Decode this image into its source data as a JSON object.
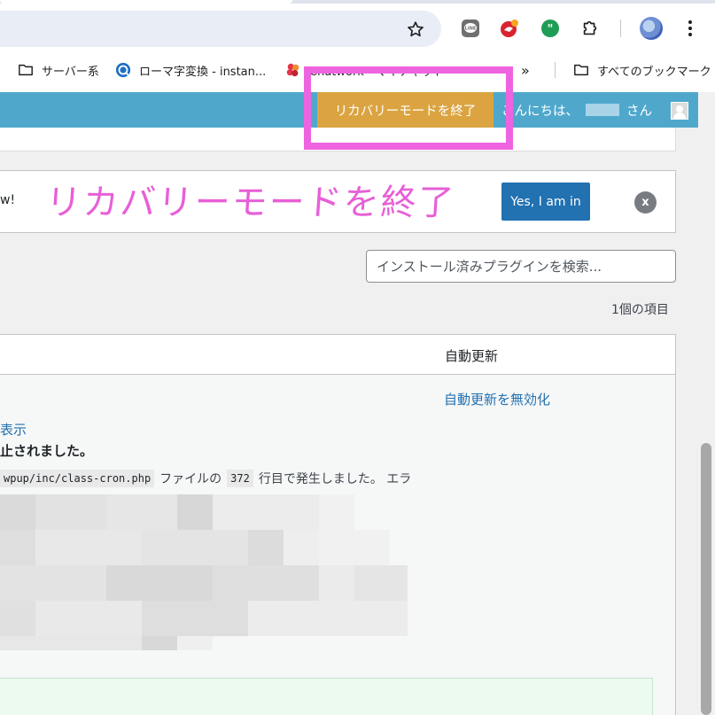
{
  "browser": {
    "bookmarks": [
      {
        "label": "サーバー系",
        "icon": "folder-icon"
      },
      {
        "label": "ローマ字変換 - instan...",
        "icon": "globe-icon"
      },
      {
        "label": "Chatwork - マイチャット",
        "icon": "chatwork-icon"
      }
    ],
    "bookmarks_overflow": "»",
    "all_bookmarks": "すべてのブックマーク",
    "extensions": [
      "line-icon",
      "redbird-icon",
      "green-quote-icon",
      "puzzle-icon"
    ]
  },
  "admin_bar": {
    "recovery_exit": "リカバリーモードを終了",
    "greeting_prefix": "こんにちは、",
    "greeting_suffix": "さん",
    "accent_color": "#4fa8cc",
    "button_color": "#dba441"
  },
  "notice": {
    "text": "w!",
    "yes_button": "Yes, I am in",
    "dismiss": "x"
  },
  "annotation": {
    "handwritten": "リカバリーモードを終了",
    "color": "#ee64e0"
  },
  "plugins": {
    "search_placeholder": "インストール済みプラグインを検索...",
    "item_count": "1個の項目",
    "column_auto_update": "自動更新",
    "disable_autoupdate": "自動更新を無効化",
    "show_details": "表示",
    "stopped_message": "止されました。",
    "error": {
      "file": "wpup/inc/class-cron.php",
      "text1": "ファイルの",
      "line": "372",
      "text2": "行目で発生しました。 エラ"
    }
  }
}
